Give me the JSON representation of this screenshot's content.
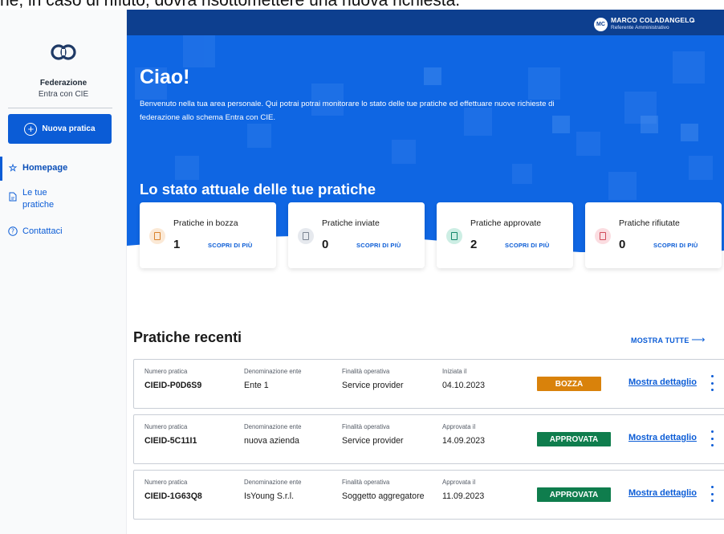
{
  "caption": "ne, in caso di rifiuto, dovrà risottomettere una nuova richiesta.",
  "sidebar": {
    "brand_title": "Federazione",
    "brand_sub": "Entra con CIE",
    "new_button": "Nuova pratica",
    "items": [
      {
        "label": "Homepage",
        "icon": "star-icon",
        "active": true
      },
      {
        "label": "Le tue pratiche",
        "icon": "document-icon",
        "active": false
      },
      {
        "label": "Contattaci",
        "icon": "help-circle-icon",
        "active": false
      }
    ]
  },
  "header": {
    "avatar": "MC",
    "user_name": "MARCO COLADANGELO",
    "user_role": "Referente Amministrativo"
  },
  "hero": {
    "title": "Ciao!",
    "text": "Benvenuto nella tua area personale. Qui potrai potrai monitorare lo stato delle tue pratiche ed effettuare nuove richieste di federazione allo schema Entra con CIE.",
    "status_title": "Lo stato attuale delle tue pratiche"
  },
  "status_cards": [
    {
      "label": "Pratiche in bozza",
      "count": "1",
      "link": "SCOPRI DI PIÙ",
      "color": "#d9822b",
      "bg": "#fbe9d6"
    },
    {
      "label": "Pratiche inviate",
      "count": "0",
      "link": "SCOPRI DI PIÙ",
      "color": "#7b8593",
      "bg": "#e6e9ee"
    },
    {
      "label": "Pratiche approvate",
      "count": "2",
      "link": "SCOPRI DI PIÙ",
      "color": "#12876b",
      "bg": "#cdeee4"
    },
    {
      "label": "Pratiche rifiutate",
      "count": "0",
      "link": "SCOPRI DI PIÙ",
      "color": "#d14b5a",
      "bg": "#fbdde1"
    }
  ],
  "recent": {
    "title": "Pratiche recenti",
    "show_all": "MOSTRA TUTTE",
    "detail_label": "Mostra dettaglio",
    "rows": [
      {
        "numero_label": "Numero pratica",
        "numero": "CIEID-P0D6S9",
        "ente_label": "Denominazione ente",
        "ente": "Ente 1",
        "finalita_label": "Finalità operativa",
        "finalita": "Service provider",
        "data_label": "Iniziata il",
        "data": "04.10.2023",
        "status": "BOZZA",
        "status_color": "#d9820b"
      },
      {
        "numero_label": "Numero pratica",
        "numero": "CIEID-5C11I1",
        "ente_label": "Denominazione ente",
        "ente": "nuova azienda",
        "finalita_label": "Finalità operativa",
        "finalita": "Service provider",
        "data_label": "Approvata il",
        "data": "14.09.2023",
        "status": "APPROVATA",
        "status_color": "#0f7d4d"
      },
      {
        "numero_label": "Numero pratica",
        "numero": "CIEID-1G63Q8",
        "ente_label": "Denominazione ente",
        "ente": "IsYoung S.r.l.",
        "finalita_label": "Finalità operativa",
        "finalita": "Soggetto aggregatore",
        "data_label": "Approvata il",
        "data": "11.09.2023",
        "status": "APPROVATA",
        "status_color": "#0f7d4d"
      }
    ]
  }
}
